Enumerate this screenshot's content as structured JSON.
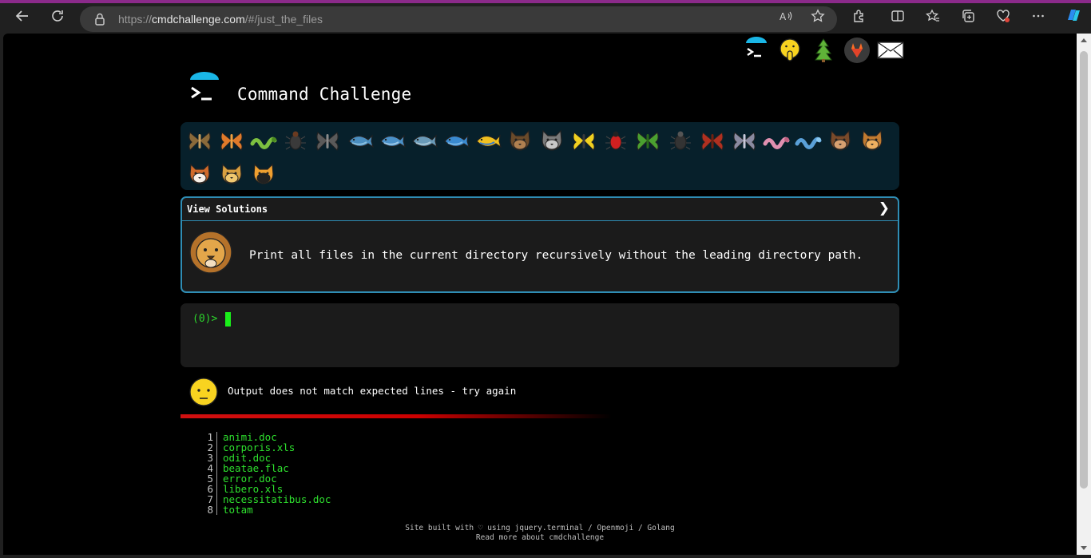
{
  "browser": {
    "url_prefix": "https://",
    "url_host": "cmdchallenge.com",
    "url_path": "/#/just_the_files"
  },
  "page": {
    "title": "Command Challenge",
    "solutions": {
      "label": "View Solutions",
      "chevron": "❯",
      "challenge_text": "Print all files in the current directory recursively without the leading directory path."
    },
    "terminal": {
      "prompt": "(0)>"
    },
    "status_message": "Output does not match expected lines - try again",
    "output_lines": [
      {
        "n": "1",
        "text": "animi.doc"
      },
      {
        "n": "2",
        "text": "corporis.xls"
      },
      {
        "n": "3",
        "text": "odit.doc"
      },
      {
        "n": "4",
        "text": "beatae.flac"
      },
      {
        "n": "5",
        "text": "error.doc"
      },
      {
        "n": "6",
        "text": "libero.xls"
      },
      {
        "n": "7",
        "text": "necessitatibus.doc"
      },
      {
        "n": "8",
        "text": "totam"
      }
    ],
    "footer": {
      "line1": "Site built with ♡ using jquery.terminal / Openmoji / Golang",
      "line2": "Read more about cmdchallenge"
    }
  },
  "icons": {
    "creatures": [
      "snail-icon",
      "butterfly-icon",
      "caterpillar-icon",
      "ant-icon",
      "spiral-shell-icon",
      "whale-icon",
      "dolphin-icon",
      "shark-icon",
      "fish-icon",
      "tropical-fish-icon",
      "hedgehog-icon",
      "wolf-icon",
      "bee-icon",
      "ladybug-icon",
      "cricket-icon",
      "spider-icon",
      "scorpion-icon",
      "fly-icon",
      "worm-icon",
      "microbe-icon",
      "monkey-icon",
      "dog-icon",
      "fox-icon",
      "cat-icon",
      "tiger-icon"
    ]
  },
  "colors": {
    "accent_blue": "#2f8db4",
    "terminal_green": "#2ee02e",
    "error_red": "#d01010"
  }
}
